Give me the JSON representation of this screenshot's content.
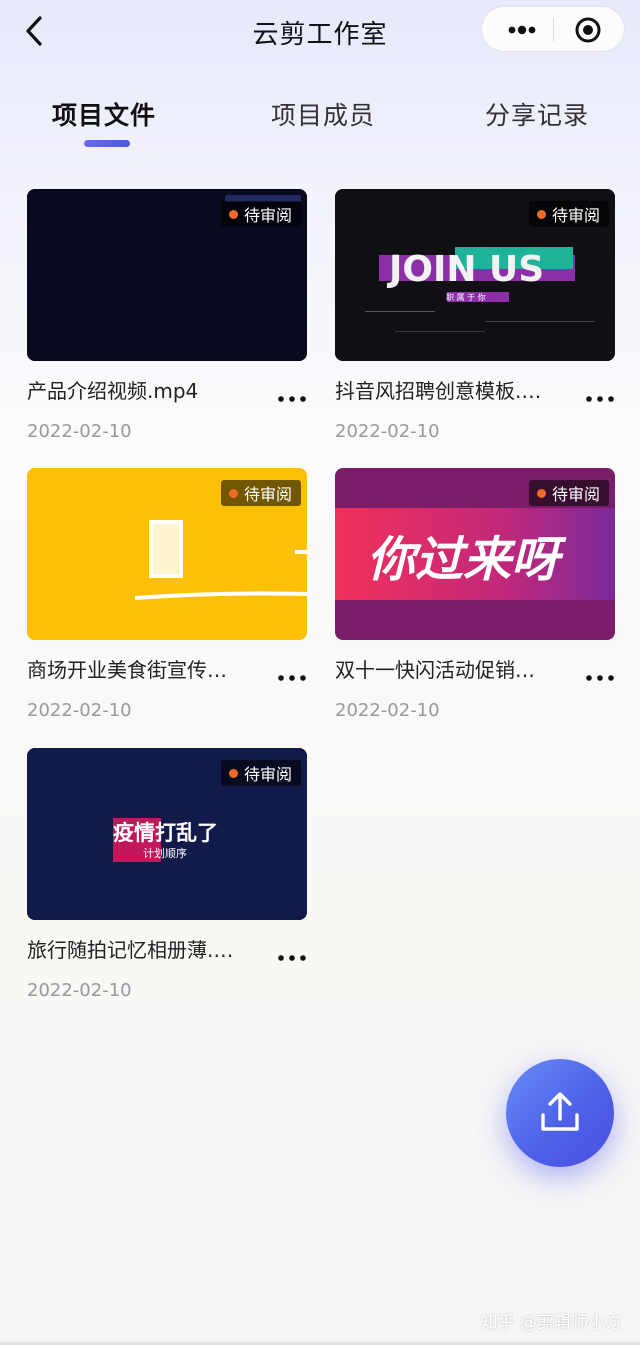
{
  "nav": {
    "title": "云剪工作室",
    "back_icon": "chevron-left-icon",
    "more_icon": "more-horizontal-icon",
    "close_icon": "target-circle-icon"
  },
  "tabs": [
    {
      "label": "项目文件",
      "active": true
    },
    {
      "label": "项目成员",
      "active": false
    },
    {
      "label": "分享记录",
      "active": false
    }
  ],
  "files": [
    {
      "name": "产品介绍视频.mp4",
      "date": "2022-02-10",
      "status": "待审阅"
    },
    {
      "name": "抖音风招聘创意模板.…",
      "date": "2022-02-10",
      "status": "待审阅",
      "thumb_title": "JOIN US",
      "thumb_sub": "职 属 于 你"
    },
    {
      "name": "商场开业美食街宣传…",
      "date": "2022-02-10",
      "status": "待审阅"
    },
    {
      "name": "双十一快闪活动促销…",
      "date": "2022-02-10",
      "status": "待审阅",
      "thumb_title": "你过来呀"
    },
    {
      "name": "旅行随拍记忆相册薄.…",
      "date": "2022-02-10",
      "status": "待审阅",
      "thumb_title": "疫情打乱了",
      "thumb_sub": "计划顺序"
    }
  ],
  "upload_icon": "upload-icon",
  "watermark": "知乎 @剪辑师小方",
  "colors": {
    "accent": "#5b5ef0",
    "status_dot": "#f26a2a",
    "date_text": "#999999"
  }
}
